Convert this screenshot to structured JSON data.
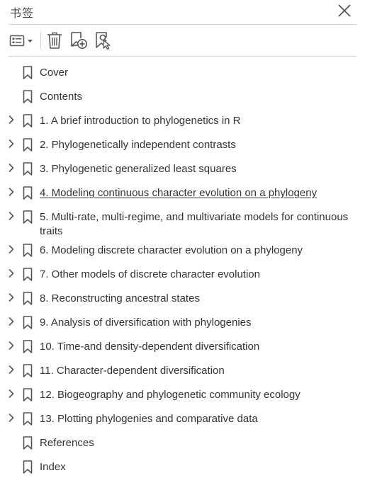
{
  "panel": {
    "title": "书签"
  },
  "toolbar": {
    "options": "options-menu",
    "delete": "delete",
    "new_bookmark": "new-bookmark",
    "find_bookmark": "find-current-bookmark"
  },
  "bookmarks": [
    {
      "label": "Cover",
      "expandable": false
    },
    {
      "label": "Contents",
      "expandable": false
    },
    {
      "label": "1. A brief introduction to phylogenetics in R",
      "expandable": true
    },
    {
      "label": "2. Phylogenetically independent contrasts",
      "expandable": true
    },
    {
      "label": "3. Phylogenetic generalized least squares",
      "expandable": true
    },
    {
      "label": "4. Modeling continuous character evolution on a phylogeny",
      "expandable": true,
      "active": true
    },
    {
      "label": "5. Multi-rate, multi-regime, and multivariate models for continuous traits",
      "expandable": true
    },
    {
      "label": "6. Modeling discrete character evolution on a phylogeny",
      "expandable": true
    },
    {
      "label": "7. Other models of discrete character evolution",
      "expandable": true
    },
    {
      "label": "8. Reconstructing ancestral states",
      "expandable": true
    },
    {
      "label": "9. Analysis of diversification with phylogenies",
      "expandable": true
    },
    {
      "label": "10. Time-and density-dependent diversification",
      "expandable": true
    },
    {
      "label": "11. Character-dependent diversification",
      "expandable": true
    },
    {
      "label": "12. Biogeography and phylogenetic community ecology",
      "expandable": true
    },
    {
      "label": "13. Plotting phylogenies and comparative data",
      "expandable": true
    },
    {
      "label": "References",
      "expandable": false
    },
    {
      "label": "Index",
      "expandable": false
    }
  ],
  "colors": {
    "icon": "#555555",
    "text": "#333333",
    "divider": "#d6d6d6"
  }
}
